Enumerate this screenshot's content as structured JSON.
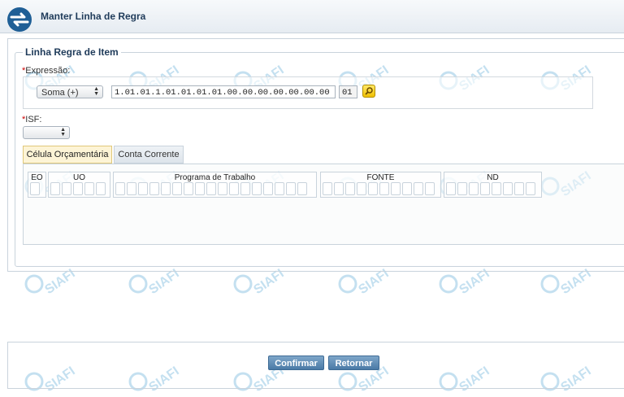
{
  "header": {
    "title": "Manter Linha de Regra",
    "logo_icon": "siafi-logo-icon"
  },
  "form": {
    "legend": "Linha Regra de Item",
    "required_mark": "*",
    "expressao_label": "Expressão:",
    "operacao_select": {
      "selected": "Soma (+)"
    },
    "conta_field": {
      "value": "1.01.01.1.01.01.01.01.00.00.00.00.00.00.00"
    },
    "suffix_field": {
      "value": "01"
    },
    "search_button_icon": "search-icon",
    "isf_label": "ISF:",
    "isf_select": {
      "selected": ""
    }
  },
  "tabs": [
    {
      "label": "Célula Orçamentária",
      "active": true
    },
    {
      "label": "Conta Corrente",
      "active": false
    }
  ],
  "cell_groups": [
    {
      "label": "EO",
      "cells": 1
    },
    {
      "label": "UO",
      "cells": 5
    },
    {
      "label": "Programa de Trabalho",
      "cells": 17
    },
    {
      "label": "FONTE",
      "cells": 10
    },
    {
      "label": "ND",
      "cells": 8
    }
  ],
  "footer": {
    "confirm_label": "Confirmar",
    "back_label": "Retornar"
  },
  "watermark_text": "SIAFI",
  "colors": {
    "title": "#1f3b5a",
    "button": "#4a7aa6",
    "active_tab": "#fdf4d6",
    "required": "#cc0000"
  }
}
